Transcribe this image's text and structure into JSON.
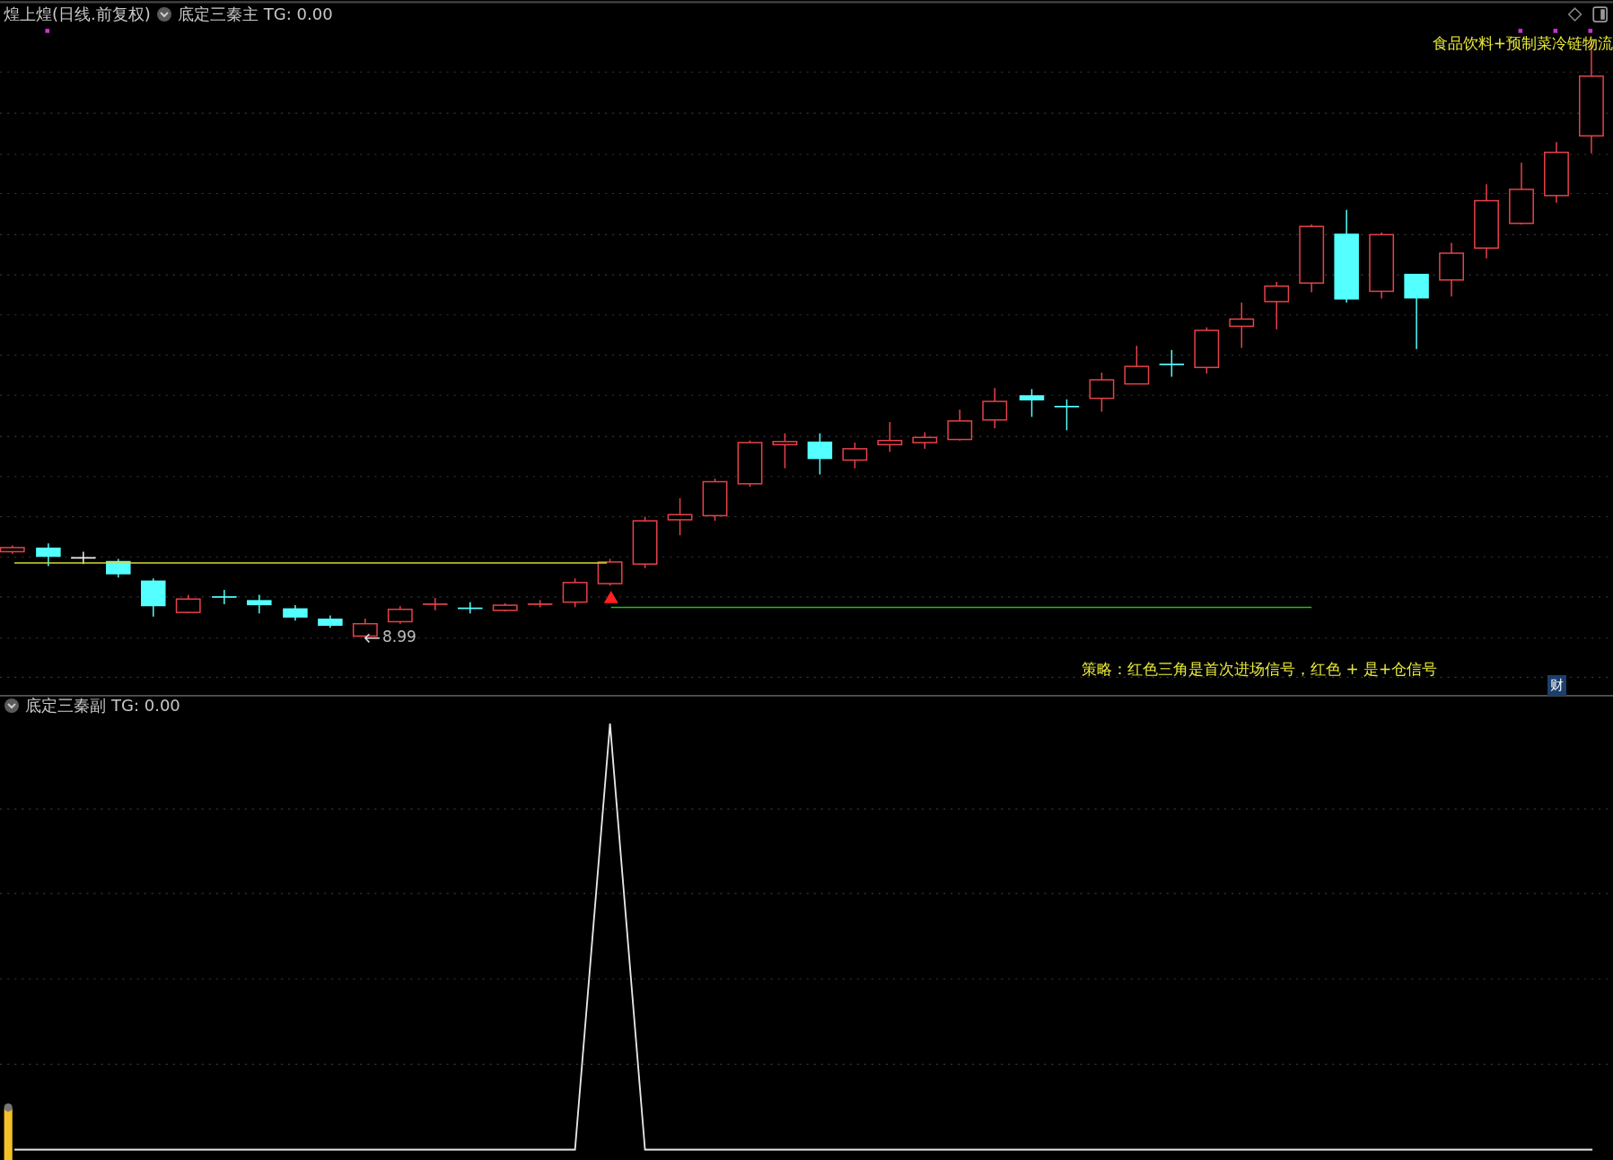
{
  "main_panel": {
    "header": {
      "stock_label": "煌上煌(日线.前复权)",
      "indicator_name": "底定三秦主",
      "tg": "TG: 0.00"
    },
    "sector_label": "食品饮料+预制菜冷链物流",
    "low_price_label": "8.99",
    "strategy_note": "策略：红色三角是首次进场信号，红色 + 是+仓信号",
    "finance_badge": "财"
  },
  "sub_panel": {
    "header": {
      "indicator_name": "底定三秦副",
      "tg": "TG: 0.00"
    }
  }
}
